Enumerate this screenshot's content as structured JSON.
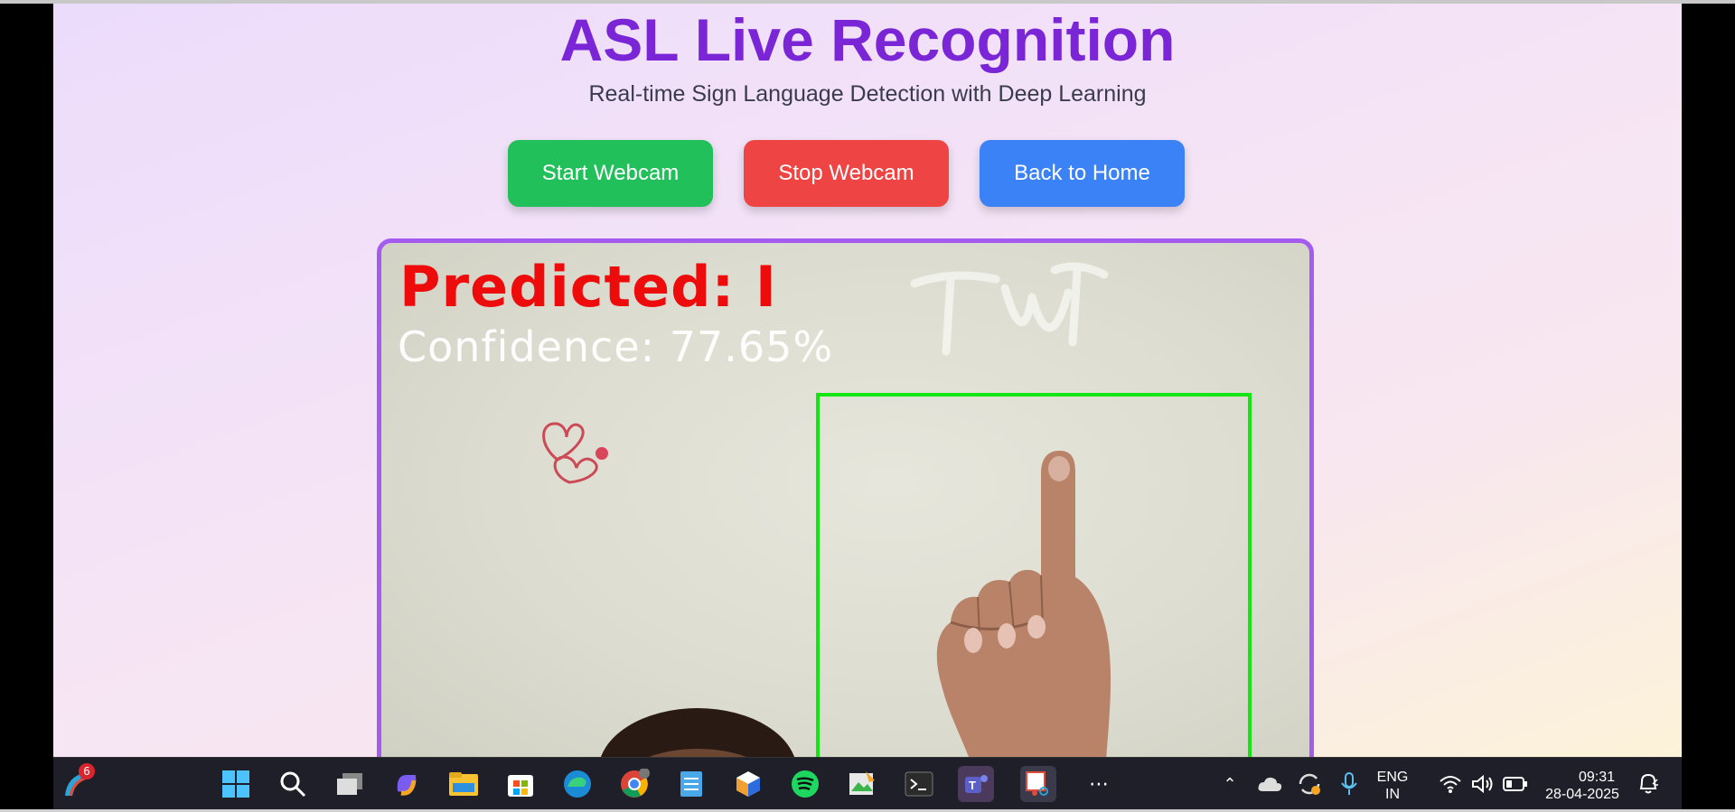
{
  "page": {
    "title": "ASL Live Recognition",
    "subtitle": "Real-time Sign Language Detection with Deep Learning"
  },
  "buttons": {
    "start_label": "Start Webcam",
    "stop_label": "Stop Webcam",
    "home_label": "Back to Home"
  },
  "colors": {
    "title": "#7b26d6",
    "start": "#22c05a",
    "stop": "#ef4444",
    "home": "#3b82f6",
    "video_border": "#a45bef",
    "prediction_text": "#ee0b0b",
    "bounding_box": "#14e614"
  },
  "video_overlay": {
    "prediction": "Predicted: I",
    "confidence": "Confidence: 77.65%"
  },
  "taskbar": {
    "badge_count": "6",
    "icons": [
      "weather-icon",
      "windows-start-icon",
      "search-icon",
      "task-view-icon",
      "copilot-icon",
      "file-explorer-icon",
      "store-icon",
      "edge-icon",
      "chrome-icon",
      "notepad-icon",
      "app-cube-icon",
      "spotify-icon",
      "paint-icon",
      "terminal-icon",
      "teams-icon",
      "snipping-tool-icon",
      "more-icon"
    ],
    "tray": {
      "language_line1": "ENG",
      "language_line2": "IN",
      "time": "09:31",
      "date": "28-04-2025"
    }
  }
}
